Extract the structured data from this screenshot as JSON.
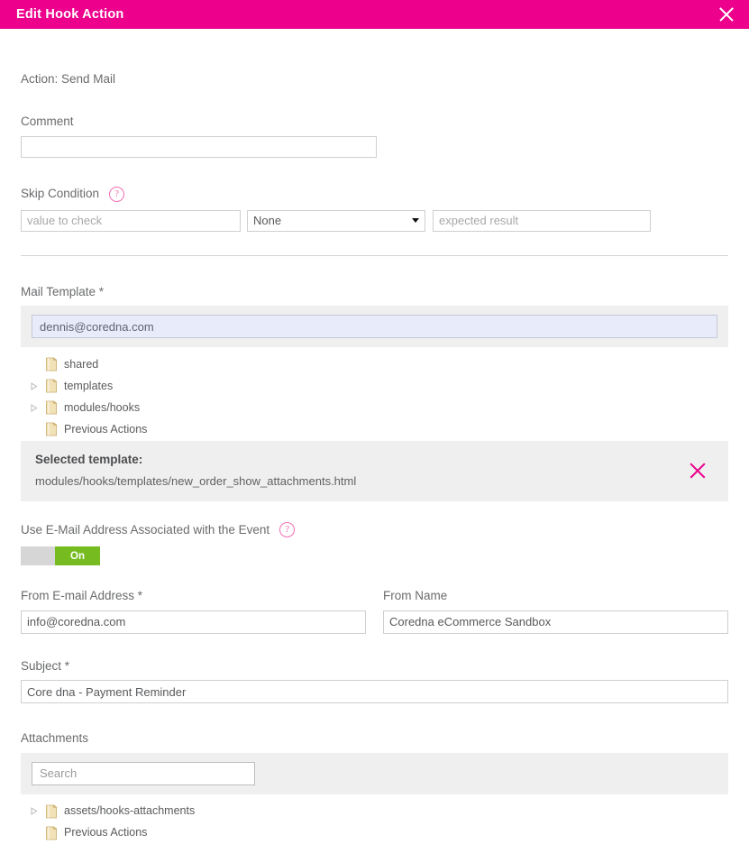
{
  "titlebar": {
    "title": "Edit Hook Action",
    "close_icon": "close-icon"
  },
  "form": {
    "action_line": "Action: Send Mail",
    "comment": {
      "label": "Comment",
      "value": "",
      "placeholder": ""
    },
    "skip_condition": {
      "label": "Skip Condition",
      "help_icon": "?",
      "value_placeholder": "value to check",
      "value": "",
      "operator_selected": "None",
      "operator_options": [
        "None"
      ],
      "expected_placeholder": "expected result",
      "expected_value": ""
    },
    "mail_template": {
      "label": "Mail Template *",
      "search_value": "dennis@coredna.com",
      "search_placeholder": "",
      "tree": [
        {
          "label": "shared",
          "expandable": false
        },
        {
          "label": "templates",
          "expandable": true
        },
        {
          "label": "modules/hooks",
          "expandable": true
        },
        {
          "label": "Previous Actions",
          "expandable": false
        }
      ]
    },
    "selected_template": {
      "title": "Selected template:",
      "path": "modules/hooks/templates/new_order_show_attachments.html",
      "clear_icon": "close-icon"
    },
    "use_event_email": {
      "label": "Use E-Mail Address Associated with the Event",
      "help_icon": "?",
      "toggle_state": "On"
    },
    "from_email": {
      "label": "From E-mail Address *",
      "value": "info@coredna.com"
    },
    "from_name": {
      "label": "From Name",
      "value": "Coredna eCommerce Sandbox"
    },
    "subject": {
      "label": "Subject *",
      "value": "Core dna - Payment Reminder"
    },
    "attachments": {
      "label": "Attachments",
      "search_value": "",
      "search_placeholder": "Search",
      "tree": [
        {
          "label": "assets/hooks-attachments",
          "expandable": true
        },
        {
          "label": "Previous Actions",
          "expandable": false
        }
      ]
    }
  },
  "colors": {
    "brand_magenta": "#EC008C",
    "toggle_green": "#76bc21",
    "help_pink": "#F06FB4",
    "panel_gray": "#efefef"
  }
}
